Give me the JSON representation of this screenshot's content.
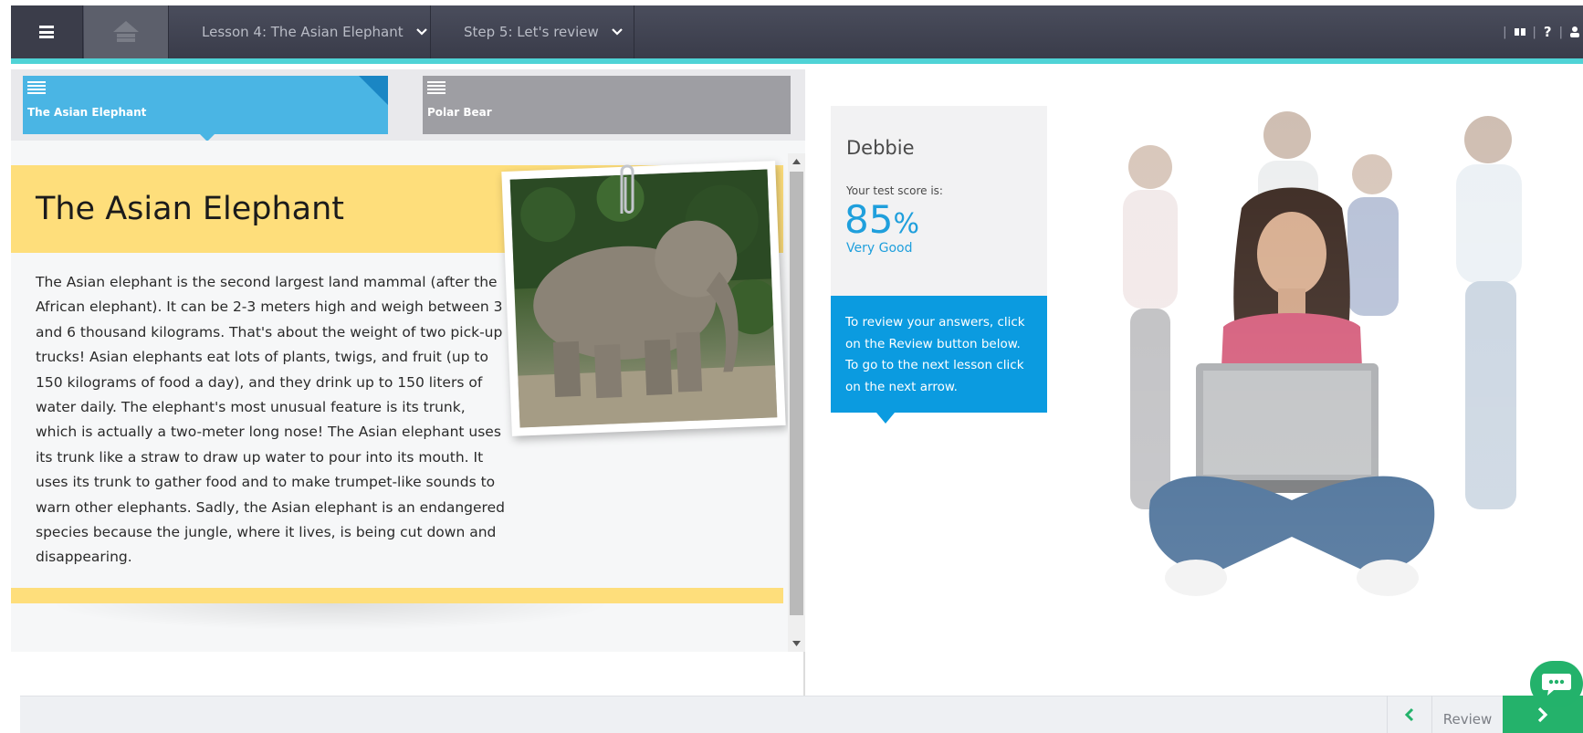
{
  "header": {
    "lesson_label": "Lesson 4: The Asian Elephant",
    "step_label": "Step 5: Let's review",
    "help_label": "?"
  },
  "tabs": [
    {
      "label": "The Asian Elephant",
      "active": true
    },
    {
      "label": "Polar Bear",
      "active": false
    }
  ],
  "article": {
    "title": "The Asian Elephant",
    "body": "The Asian elephant is the second largest land mammal (after the African elephant). It can be 2-3 meters high and weigh between 3 and 6 thousand kilograms. That's about the weight of two pick-up trucks! Asian elephants eat lots of plants, twigs, and fruit (up to 150 kilograms of food a day), and they drink up to 150 liters of water daily. The elephant's most unusual feature is its trunk, which is actually a two-meter long nose! The Asian elephant uses its trunk like a straw to draw up water to pour into its mouth. It uses its trunk to gather food and to make trumpet-like sounds to warn other elephants. Sadly, the Asian elephant is an endangered species because the jungle, where it lives, is being cut down and disappearing."
  },
  "score_card": {
    "name": "Debbie",
    "score_label": "Your test score is:",
    "score_value": "85",
    "score_unit": "%",
    "rating": "Very Good",
    "tip": "To review your answers, click on the Review button below. To go to the next lesson click on the next arrow."
  },
  "footer": {
    "review_label": "Review"
  },
  "colors": {
    "accent": "#4fd3d6",
    "tab_active": "#4ab5e4",
    "tab_inactive": "#9e9ea3",
    "highlight": "#fede7b",
    "score_blue": "#1f9fdc",
    "next_green": "#24b26b"
  },
  "icons": [
    "menu-icon",
    "home-icon",
    "chevron-down-icon",
    "book-icon",
    "help-icon",
    "user-icon",
    "document-icon",
    "paperclip-icon",
    "chevron-left-icon",
    "chevron-right-icon",
    "chat-icon"
  ]
}
